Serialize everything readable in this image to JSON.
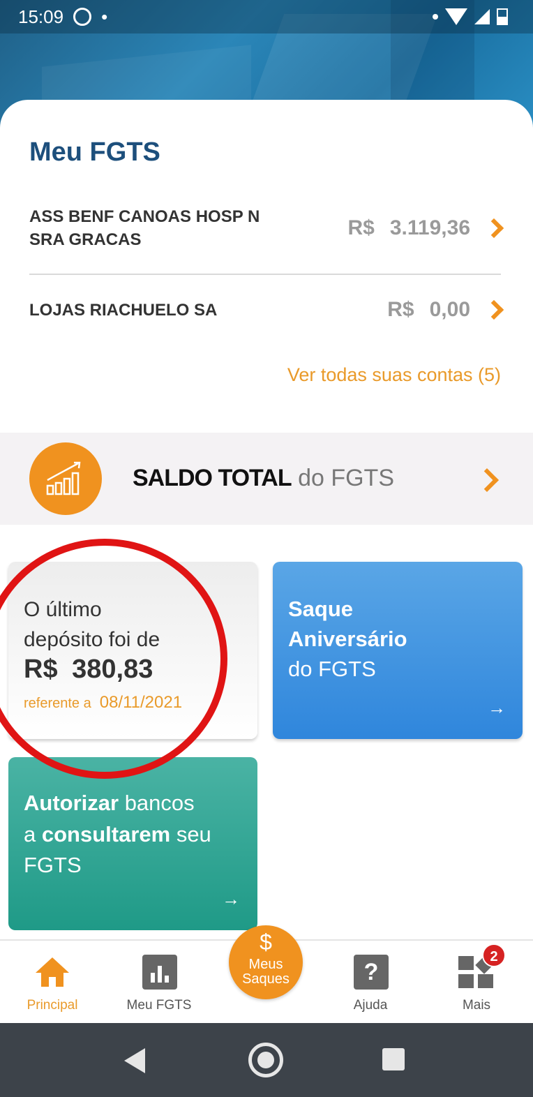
{
  "status_bar": {
    "time": "15:09",
    "dot": "•"
  },
  "card": {
    "title": "Meu FGTS",
    "accounts": [
      {
        "name": "ASS BENF CANOAS HOSP N SRA GRACAS",
        "currency": "R$",
        "amount": "3.119,36"
      },
      {
        "name": "LOJAS RIACHUELO SA",
        "currency": "R$",
        "amount": "0,00"
      }
    ],
    "see_all": "Ver todas suas contas (5)"
  },
  "saldo": {
    "strong": "SALDO TOTAL",
    "light": "do FGTS"
  },
  "deposit_tile": {
    "line1": "O último",
    "line2": "depósito foi de",
    "amount": "R$ 380,83",
    "ref_label": "referente a",
    "ref_date": "08/11/2021"
  },
  "saque_tile": {
    "line1": "Saque",
    "line2": "Aniversário",
    "line3": "do FGTS",
    "arrow": "→"
  },
  "autorizar_tile": {
    "w1": "Autorizar",
    "w2": " bancos",
    "w3": "a ",
    "w4": "consultarem",
    "w5": " seu",
    "w6": "FGTS",
    "arrow": "→"
  },
  "nav": {
    "principal": "Principal",
    "meu_fgts": "Meu FGTS",
    "fab_symbol": "$",
    "fab_line1": "Meus",
    "fab_line2": "Saques",
    "ajuda": "Ajuda",
    "ajuda_icon": "?",
    "mais": "Mais",
    "mais_badge": "2"
  },
  "colors": {
    "accent_orange": "#f0921f",
    "title_blue": "#1d4f7c",
    "saque_blue": "#2f86dc",
    "autorizar_teal": "#1f9a87",
    "annotation_red": "#e01414"
  }
}
